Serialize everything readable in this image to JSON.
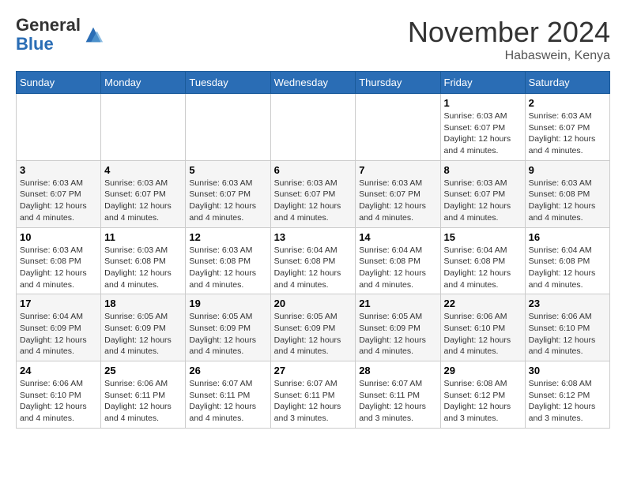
{
  "logo": {
    "general": "General",
    "blue": "Blue"
  },
  "title": "November 2024",
  "location": "Habaswein, Kenya",
  "days_of_week": [
    "Sunday",
    "Monday",
    "Tuesday",
    "Wednesday",
    "Thursday",
    "Friday",
    "Saturday"
  ],
  "weeks": [
    [
      {
        "day": "",
        "info": ""
      },
      {
        "day": "",
        "info": ""
      },
      {
        "day": "",
        "info": ""
      },
      {
        "day": "",
        "info": ""
      },
      {
        "day": "",
        "info": ""
      },
      {
        "day": "1",
        "info": "Sunrise: 6:03 AM\nSunset: 6:07 PM\nDaylight: 12 hours\nand 4 minutes."
      },
      {
        "day": "2",
        "info": "Sunrise: 6:03 AM\nSunset: 6:07 PM\nDaylight: 12 hours\nand 4 minutes."
      }
    ],
    [
      {
        "day": "3",
        "info": "Sunrise: 6:03 AM\nSunset: 6:07 PM\nDaylight: 12 hours\nand 4 minutes."
      },
      {
        "day": "4",
        "info": "Sunrise: 6:03 AM\nSunset: 6:07 PM\nDaylight: 12 hours\nand 4 minutes."
      },
      {
        "day": "5",
        "info": "Sunrise: 6:03 AM\nSunset: 6:07 PM\nDaylight: 12 hours\nand 4 minutes."
      },
      {
        "day": "6",
        "info": "Sunrise: 6:03 AM\nSunset: 6:07 PM\nDaylight: 12 hours\nand 4 minutes."
      },
      {
        "day": "7",
        "info": "Sunrise: 6:03 AM\nSunset: 6:07 PM\nDaylight: 12 hours\nand 4 minutes."
      },
      {
        "day": "8",
        "info": "Sunrise: 6:03 AM\nSunset: 6:07 PM\nDaylight: 12 hours\nand 4 minutes."
      },
      {
        "day": "9",
        "info": "Sunrise: 6:03 AM\nSunset: 6:08 PM\nDaylight: 12 hours\nand 4 minutes."
      }
    ],
    [
      {
        "day": "10",
        "info": "Sunrise: 6:03 AM\nSunset: 6:08 PM\nDaylight: 12 hours\nand 4 minutes."
      },
      {
        "day": "11",
        "info": "Sunrise: 6:03 AM\nSunset: 6:08 PM\nDaylight: 12 hours\nand 4 minutes."
      },
      {
        "day": "12",
        "info": "Sunrise: 6:03 AM\nSunset: 6:08 PM\nDaylight: 12 hours\nand 4 minutes."
      },
      {
        "day": "13",
        "info": "Sunrise: 6:04 AM\nSunset: 6:08 PM\nDaylight: 12 hours\nand 4 minutes."
      },
      {
        "day": "14",
        "info": "Sunrise: 6:04 AM\nSunset: 6:08 PM\nDaylight: 12 hours\nand 4 minutes."
      },
      {
        "day": "15",
        "info": "Sunrise: 6:04 AM\nSunset: 6:08 PM\nDaylight: 12 hours\nand 4 minutes."
      },
      {
        "day": "16",
        "info": "Sunrise: 6:04 AM\nSunset: 6:08 PM\nDaylight: 12 hours\nand 4 minutes."
      }
    ],
    [
      {
        "day": "17",
        "info": "Sunrise: 6:04 AM\nSunset: 6:09 PM\nDaylight: 12 hours\nand 4 minutes."
      },
      {
        "day": "18",
        "info": "Sunrise: 6:05 AM\nSunset: 6:09 PM\nDaylight: 12 hours\nand 4 minutes."
      },
      {
        "day": "19",
        "info": "Sunrise: 6:05 AM\nSunset: 6:09 PM\nDaylight: 12 hours\nand 4 minutes."
      },
      {
        "day": "20",
        "info": "Sunrise: 6:05 AM\nSunset: 6:09 PM\nDaylight: 12 hours\nand 4 minutes."
      },
      {
        "day": "21",
        "info": "Sunrise: 6:05 AM\nSunset: 6:09 PM\nDaylight: 12 hours\nand 4 minutes."
      },
      {
        "day": "22",
        "info": "Sunrise: 6:06 AM\nSunset: 6:10 PM\nDaylight: 12 hours\nand 4 minutes."
      },
      {
        "day": "23",
        "info": "Sunrise: 6:06 AM\nSunset: 6:10 PM\nDaylight: 12 hours\nand 4 minutes."
      }
    ],
    [
      {
        "day": "24",
        "info": "Sunrise: 6:06 AM\nSunset: 6:10 PM\nDaylight: 12 hours\nand 4 minutes."
      },
      {
        "day": "25",
        "info": "Sunrise: 6:06 AM\nSunset: 6:11 PM\nDaylight: 12 hours\nand 4 minutes."
      },
      {
        "day": "26",
        "info": "Sunrise: 6:07 AM\nSunset: 6:11 PM\nDaylight: 12 hours\nand 4 minutes."
      },
      {
        "day": "27",
        "info": "Sunrise: 6:07 AM\nSunset: 6:11 PM\nDaylight: 12 hours\nand 3 minutes."
      },
      {
        "day": "28",
        "info": "Sunrise: 6:07 AM\nSunset: 6:11 PM\nDaylight: 12 hours\nand 3 minutes."
      },
      {
        "day": "29",
        "info": "Sunrise: 6:08 AM\nSunset: 6:12 PM\nDaylight: 12 hours\nand 3 minutes."
      },
      {
        "day": "30",
        "info": "Sunrise: 6:08 AM\nSunset: 6:12 PM\nDaylight: 12 hours\nand 3 minutes."
      }
    ]
  ]
}
